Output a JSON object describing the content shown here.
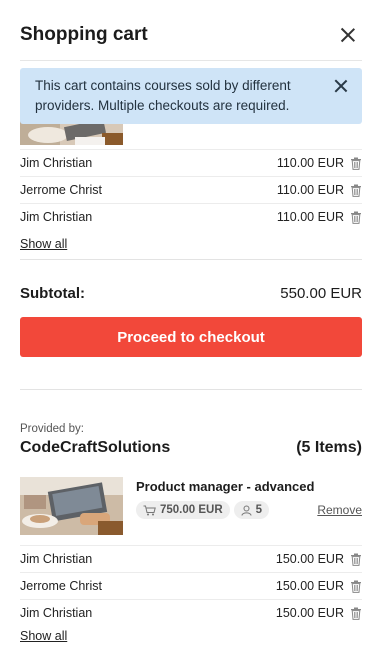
{
  "header": {
    "title": "Shopping cart"
  },
  "notice": {
    "text": "This cart contains courses sold by different providers. Multiple checkouts are required."
  },
  "first_group": {
    "participants": [
      {
        "name": "Jim Christian",
        "price": "110.00 EUR"
      },
      {
        "name": "Jerrome Christ",
        "price": "110.00 EUR"
      },
      {
        "name": "Jim Christian",
        "price": "110.00 EUR"
      }
    ],
    "show_all_label": "Show all",
    "subtotal_label": "Subtotal:",
    "subtotal_value": "550.00 EUR",
    "checkout_label": "Proceed to checkout"
  },
  "second_group": {
    "provided_by_label": "Provided by:",
    "provider_name": "CodeCraftSolutions",
    "item_count": "(5 Items)",
    "course": {
      "title": "Product manager - advanced",
      "price": "750.00 EUR",
      "participants": "5",
      "remove_label": "Remove"
    },
    "participants": [
      {
        "name": "Jim Christian",
        "price": "150.00 EUR"
      },
      {
        "name": "Jerrome Christ",
        "price": "150.00 EUR"
      },
      {
        "name": "Jim Christian",
        "price": "150.00 EUR"
      }
    ],
    "show_all_label": "Show all"
  },
  "colors": {
    "accent": "#f2483a",
    "notice_bg": "#cfe4f7"
  }
}
